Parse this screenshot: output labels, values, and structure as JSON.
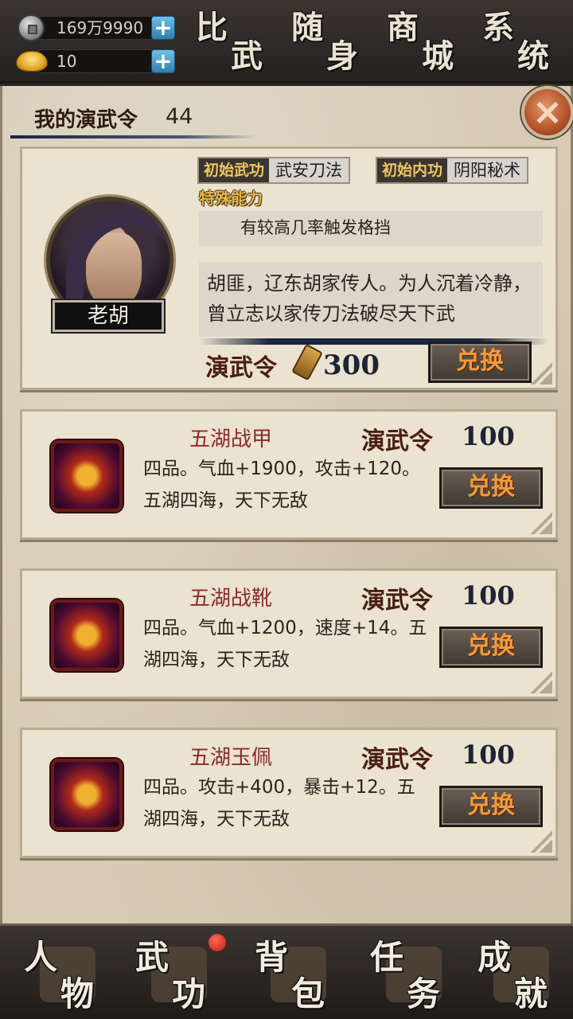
{
  "resources": {
    "silver": "169万9990",
    "gold": "10"
  },
  "top_nav": [
    {
      "label": "比武",
      "c1": "比",
      "c2": "武"
    },
    {
      "label": "随身",
      "c1": "随",
      "c2": "身"
    },
    {
      "label": "商城",
      "c1": "商",
      "c2": "城"
    },
    {
      "label": "系统",
      "c1": "系",
      "c2": "统"
    }
  ],
  "panel": {
    "title": "我的演武令",
    "count": "44",
    "close_label": "×"
  },
  "hero": {
    "name": "老胡",
    "attrs": [
      {
        "key": "初始武功",
        "value": "武安刀法"
      },
      {
        "key": "初始内功",
        "value": "阴阳秘术"
      }
    ],
    "special_label": "特殊能力",
    "special_text": "有较高几率触发格挡",
    "description": "胡匪，辽东胡家传人。为人沉着冷静，曾立志以家传刀法破尽天下武",
    "cost_label": "演武令",
    "cost_value": "300",
    "exchange_label": "兑换"
  },
  "items": [
    {
      "name": "五湖战甲",
      "cost_label": "演武令",
      "cost_value": "100",
      "desc": "四品。气血+1900，攻击+120。五湖四海，天下无敌",
      "exchange_label": "兑换"
    },
    {
      "name": "五湖战靴",
      "cost_label": "演武令",
      "cost_value": "100",
      "desc": "四品。气血+1200，速度+14。五湖四海，天下无敌",
      "exchange_label": "兑换"
    },
    {
      "name": "五湖玉佩",
      "cost_label": "演武令",
      "cost_value": "100",
      "desc": "四品。攻击+400，暴击+12。五湖四海，天下无敌",
      "exchange_label": "兑换"
    }
  ],
  "bottom_nav": [
    {
      "label": "人物",
      "c1": "人",
      "c2": "物"
    },
    {
      "label": "武功",
      "c1": "武",
      "c2": "功"
    },
    {
      "label": "背包",
      "c1": "背",
      "c2": "包"
    },
    {
      "label": "任务",
      "c1": "任",
      "c2": "务"
    },
    {
      "label": "成就",
      "c1": "成",
      "c2": "就"
    }
  ]
}
